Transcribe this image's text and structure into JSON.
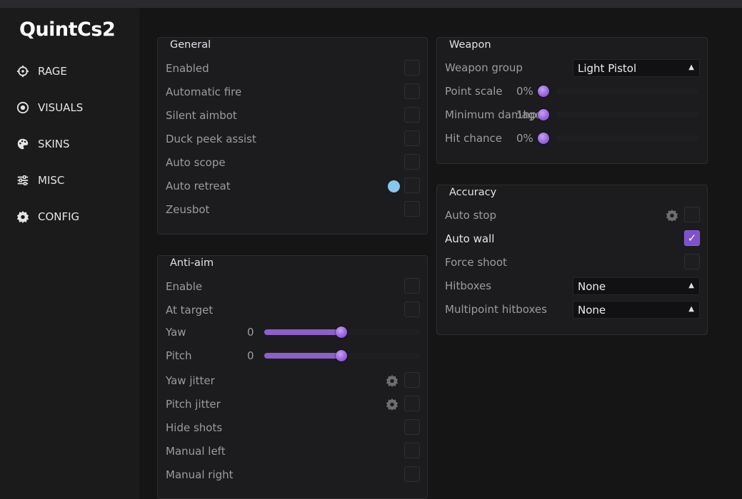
{
  "app": {
    "title": "QuintCs2"
  },
  "sidebar": {
    "items": [
      {
        "label": "RAGE",
        "icon": "crosshair-icon"
      },
      {
        "label": "VISUALS",
        "icon": "eye-icon"
      },
      {
        "label": "SKINS",
        "icon": "palette-icon"
      },
      {
        "label": "MISC",
        "icon": "sliders-icon"
      },
      {
        "label": "CONFIG",
        "icon": "gear-icon"
      }
    ]
  },
  "general": {
    "title": "General",
    "enabled": "Enabled",
    "automatic_fire": "Automatic fire",
    "silent_aimbot": "Silent aimbot",
    "duck_peek_assist": "Duck peek assist",
    "auto_scope": "Auto scope",
    "auto_retreat": "Auto retreat",
    "zeusbot": "Zeusbot"
  },
  "anti_aim": {
    "title": "Anti-aim",
    "enable": "Enable",
    "at_target": "At target",
    "yaw": {
      "label": "Yaw",
      "value": "0",
      "fill_fraction": 0.5
    },
    "pitch": {
      "label": "Pitch",
      "value": "0",
      "fill_fraction": 0.5
    },
    "yaw_jitter": "Yaw jitter",
    "pitch_jitter": "Pitch jitter",
    "hide_shots": "Hide shots",
    "manual_left": "Manual left",
    "manual_right": "Manual right"
  },
  "weapon": {
    "title": "Weapon",
    "weapon_group": {
      "label": "Weapon group",
      "value": "Light Pistol"
    },
    "point_scale": {
      "label": "Point scale",
      "value": "0%"
    },
    "minimum_damage": {
      "label": "Minimum damage",
      "value": "1hp"
    },
    "hit_chance": {
      "label": "Hit chance",
      "value": "0%"
    }
  },
  "accuracy": {
    "title": "Accuracy",
    "auto_stop": "Auto stop",
    "auto_wall": {
      "label": "Auto wall",
      "checked": true,
      "check_glyph": "✓"
    },
    "force_shoot": "Force shoot",
    "hitboxes": {
      "label": "Hitboxes",
      "value": "None"
    },
    "multipoint_hitboxes": {
      "label": "Multipoint hitboxes",
      "value": "None"
    }
  },
  "colors": {
    "accent": "#8d5fc9",
    "checkbox_on": "#7d52cc",
    "color_swatch": "#88c8ee",
    "background": "#1b1b1c"
  }
}
